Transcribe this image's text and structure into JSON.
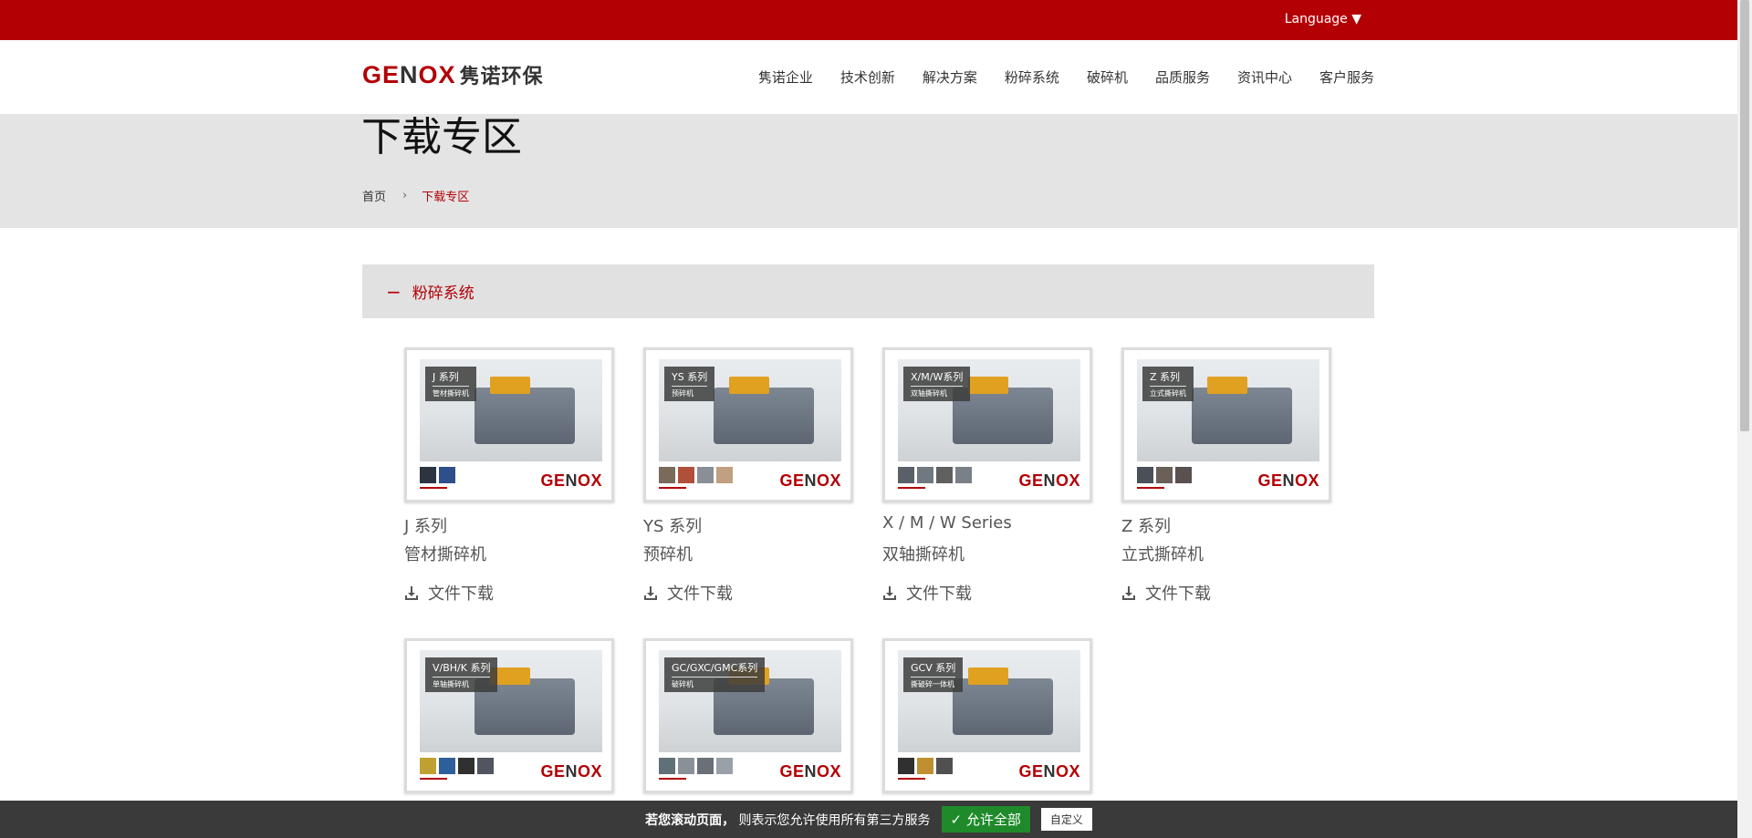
{
  "topbar": {
    "language_label": "Language ▼"
  },
  "logo": {
    "mark_left": "GE",
    "mark_n": "N",
    "mark_right": "OX",
    "text": "隽诺环保"
  },
  "nav": {
    "items": [
      "隽诺企业",
      "技术创新",
      "解决方案",
      "粉碎系统",
      "破碎机",
      "品质服务",
      "资讯中心",
      "客户服务"
    ]
  },
  "banner": {
    "title": "下载专区",
    "breadcrumb": {
      "home": "首页",
      "separator": "›",
      "current": "下载专区"
    }
  },
  "section": {
    "toggle_symbol": "−",
    "title": "粉碎系统"
  },
  "cards": [
    {
      "tag_title": "J 系列",
      "tag_sub": "管材撕碎机",
      "name": "J 系列",
      "desc": "管材撕碎机",
      "download": "文件下载",
      "swatch_colors": [
        "#2b3440",
        "#2f4f8a"
      ]
    },
    {
      "tag_title": "YS 系列",
      "tag_sub": "预碎机",
      "name": "YS 系列",
      "desc": "预碎机",
      "download": "文件下载",
      "swatch_colors": [
        "#7a6a5a",
        "#b0503a",
        "#8a8f96",
        "#c0a080"
      ]
    },
    {
      "tag_title": "X/M/W系列",
      "tag_sub": "双轴撕碎机",
      "name": "X / M / W Series",
      "desc": "双轴撕碎机",
      "download": "文件下载",
      "swatch_colors": [
        "#5a6068",
        "#707880",
        "#606060",
        "#7a8088"
      ]
    },
    {
      "tag_title": "Z 系列",
      "tag_sub": "立式撕碎机",
      "name": "Z 系列",
      "desc": "立式撕碎机",
      "download": "文件下载",
      "swatch_colors": [
        "#4a5058",
        "#6a6058",
        "#5a5050"
      ]
    },
    {
      "tag_title": "V/BH/K 系列",
      "tag_sub": "单轴撕碎机",
      "name": "",
      "desc": "",
      "download": "",
      "swatch_colors": [
        "#c0a030",
        "#2f5f9a",
        "#303030",
        "#505560"
      ]
    },
    {
      "tag_title": "GC/GXC/GMC系列",
      "tag_sub": "破碎机",
      "name": "",
      "desc": "",
      "download": "",
      "swatch_colors": [
        "#607078",
        "#8a9098",
        "#6a7078",
        "#9aa0a8"
      ]
    },
    {
      "tag_title": "GCV 系列",
      "tag_sub": "撕破碎一体机",
      "name": "",
      "desc": "",
      "download": "",
      "swatch_colors": [
        "#303030",
        "#c09030",
        "#505050"
      ]
    }
  ],
  "brand": {
    "left": "GE",
    "n": "N",
    "right": "OX"
  },
  "cookie": {
    "text_bold": "若您滚动页面，",
    "text": "则表示您允许使用所有第三方服务",
    "allow_label": "✓ 允许全部",
    "custom_label": "自定义"
  },
  "colors": {
    "brand_red": "#b30005",
    "banner_gray": "#e4e4e4",
    "allow_green": "#1f8a2a"
  }
}
